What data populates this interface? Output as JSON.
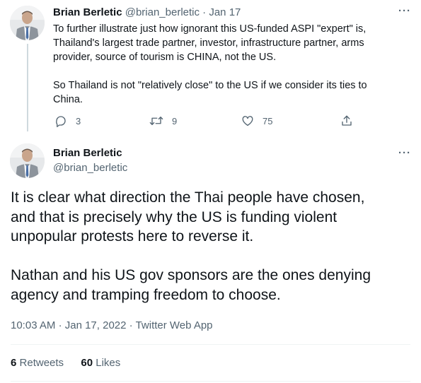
{
  "reply_tweet": {
    "author_name": "Brian Berletic",
    "handle": "@brian_berletic",
    "separator": "·",
    "date": "Jan 17",
    "text": "To further illustrate just how ignorant this US-funded ASPI \"expert\" is,\nThailand's largest trade partner, investor, infrastructure partner, arms\nprovider, source of tourism is CHINA, not the US.\n\nSo Thailand is not \"relatively close\" to the US if we consider its ties to\nChina.",
    "replies": "3",
    "retweets": "9",
    "likes": "75",
    "more": "···"
  },
  "main_tweet": {
    "author_name": "Brian Berletic",
    "handle": "@brian_berletic",
    "more": "···",
    "text": "It is clear what direction the Thai people have chosen,\nand that is precisely why the US is funding violent\nunpopular protests here to reverse it.\n\nNathan and his US gov sponsors are the ones denying\nagency and tramping freedom to choose.",
    "time": "10:03 AM",
    "dot": "·",
    "date": "Jan 17, 2022",
    "source": "Twitter Web App",
    "retweet_count": "6",
    "retweet_label": "Retweets",
    "like_count": "60",
    "like_label": "Likes"
  },
  "colors": {
    "text": "#0f1419",
    "muted": "#536471",
    "thread_line": "#cfd9de",
    "divider": "#eff3f4"
  },
  "icons": [
    "reply-icon",
    "retweet-icon",
    "like-icon",
    "share-icon",
    "more-icon"
  ]
}
